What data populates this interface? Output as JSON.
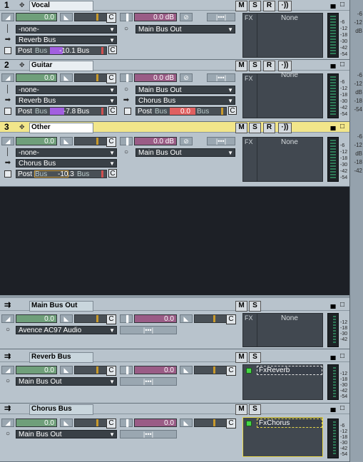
{
  "tracks": [
    {
      "number": "1",
      "name": "Vocal",
      "selected": false,
      "volume": "0.0",
      "pan": "C",
      "input": "-none-",
      "output": "Main Bus Out",
      "send": "Reverb Bus",
      "send_mode": "Post",
      "send_label": "Bus",
      "send_value": "-10.1",
      "send_bus_label": "Bus",
      "send_pan": "C",
      "send_color": "#a25fe0",
      "fx_label": "FX",
      "fx_plugin": "None",
      "out_volume": "0.0 dB"
    },
    {
      "number": "2",
      "name": "Guitar",
      "selected": false,
      "volume": "0.0",
      "pan": "C",
      "input": "-none-",
      "output": "Main Bus Out",
      "send": "Reverb Bus",
      "send_mode": "Post",
      "send_label": "Bus",
      "send_value": "-7.8",
      "send_bus_label": "Bus",
      "send_pan": "C",
      "send_color": "#a25fe0",
      "send2": "Chorus Bus",
      "send2_mode": "Post",
      "send2_label": "Bus",
      "send2_value": "0.0",
      "send2_bus_label": "Bus",
      "send2_pan": "C",
      "fx_label": "FX",
      "fx_plugin": "None",
      "out_volume": "0.0 dB"
    },
    {
      "number": "3",
      "name": "Other",
      "selected": true,
      "volume": "0.0",
      "pan": "C",
      "input": "-none-",
      "output": "Main Bus Out",
      "send": "Chorus Bus",
      "send_mode": "Post",
      "send_label": "Bus",
      "send_value": "-10.3",
      "send_bus_label": "Bus",
      "send_pan": "C",
      "fx_label": "FX",
      "fx_plugin": "None",
      "out_volume": "0.0 dB"
    }
  ],
  "buses": [
    {
      "name": "Main Bus Out",
      "volume": "0.0",
      "pan": "C",
      "output": "Avence AC97 Audio",
      "out_volume": "0.0",
      "out_pan": "C",
      "fx_label": "FX",
      "fx_plugin": "None"
    },
    {
      "name": "Reverb Bus",
      "volume": "0.0",
      "pan": "C",
      "output": "Main Bus Out",
      "out_volume": "0.0",
      "out_pan": "C",
      "fx_plugin": "FxReverb"
    },
    {
      "name": "Chorus Bus",
      "volume": "0.0",
      "pan": "C",
      "output": "Main Bus Out",
      "out_volume": "0.0",
      "out_pan": "C",
      "fx_plugin": "FxChorus"
    }
  ],
  "buttons": {
    "mute": "M",
    "solo": "S",
    "record": "R",
    "input_echo": "·)̇)"
  },
  "meter_scale": [
    "-6",
    "-12",
    "-18",
    "-30",
    "-42",
    "-54"
  ],
  "meter_scale_db": "dB",
  "side_scale": [
    "-6",
    "-12",
    "dB",
    "-18",
    "-42",
    "-54"
  ],
  "colors": {
    "panel": "#b8c3cc",
    "selected_header": "#f2e68a",
    "volume_fill": "#6f9f7a",
    "output_fill": "#9a5c86",
    "pan_marker": "#c99a2c",
    "plugin_led": "#45d845"
  }
}
